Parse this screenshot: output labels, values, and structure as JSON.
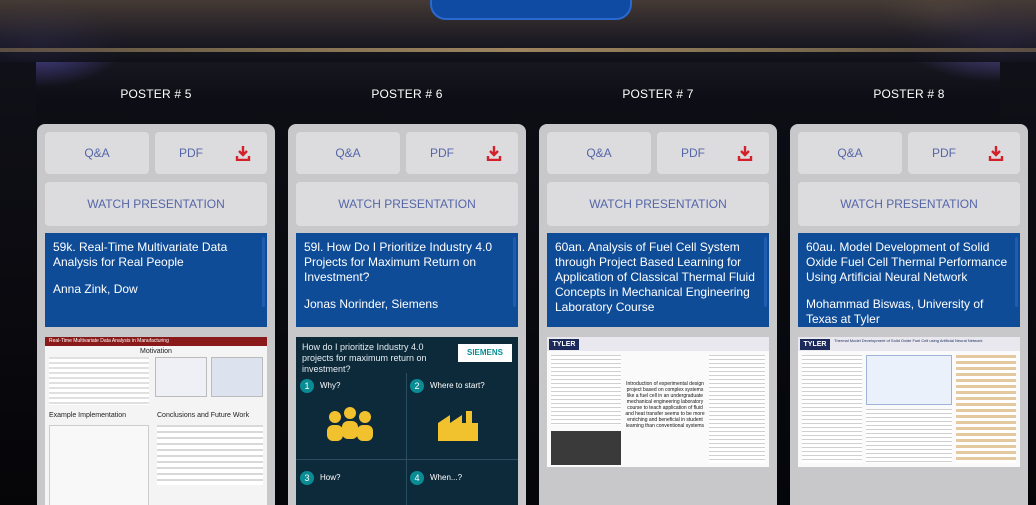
{
  "posters": [
    {
      "heading": "POSTER # 5",
      "qa_label": "Q&A",
      "pdf_label": "PDF",
      "watch_label": "WATCH PRESENTATION",
      "title": "59k. Real-Time Multivariate Data Analysis for Real People",
      "author": "Anna Zink, Dow",
      "thumb_headline": "Real-Time Multivariate Data Analysis in Manufacturing",
      "thumb_sub1": "Motivation",
      "thumb_sub2": "Example Implementation",
      "thumb_sub3": "Conclusions and Future Work"
    },
    {
      "heading": "POSTER # 6",
      "qa_label": "Q&A",
      "pdf_label": "PDF",
      "watch_label": "WATCH PRESENTATION",
      "title": "59l. How Do I Prioritize Industry 4.0 Projects for Maximum Return on Investment?",
      "author": "Jonas Norinder, Siemens",
      "thumb_headline": "How do I prioritize Industry 4.0 projects for maximum return on investment?",
      "thumb_logo": "SIEMENS",
      "thumb_q1": "Why?",
      "thumb_q2": "Where to start?",
      "thumb_q3": "How?",
      "thumb_q4": "When...?",
      "thumb_n1": "1",
      "thumb_n2": "2",
      "thumb_n3": "3",
      "thumb_n4": "4"
    },
    {
      "heading": "POSTER # 7",
      "qa_label": "Q&A",
      "pdf_label": "PDF",
      "watch_label": "WATCH PRESENTATION",
      "title": "60an. Analysis of Fuel Cell System through Project Based Learning for Application of Classical Thermal Fluid Concepts in Mechanical Engineering Laboratory Course",
      "author": "",
      "thumb_logo": "TYLER",
      "thumb_body": "Introduction of experimental design project based on complex systems like a fuel cell in an undergraduate mechanical engineering laboratory course to teach application of fluid and heat transfer seems to be more enriching and beneficial in student learning than conventional systems"
    },
    {
      "heading": "POSTER # 8",
      "qa_label": "Q&A",
      "pdf_label": "PDF",
      "watch_label": "WATCH PRESENTATION",
      "title": "60au. Model Development of Solid Oxide Fuel Cell Thermal Performance Using Artificial Neural Network",
      "author": "Mohammad Biswas, University of Texas at Tyler",
      "thumb_logo": "TYLER",
      "thumb_headline": "Thermal Model Development of Solid Oxide Fuel Cell using Artificial Neural Network"
    }
  ],
  "colors": {
    "info_bg": "#0f4c97",
    "button_text": "#5566a8",
    "download_icon": "#d3202a",
    "card_bg": "#c8c8cb"
  }
}
